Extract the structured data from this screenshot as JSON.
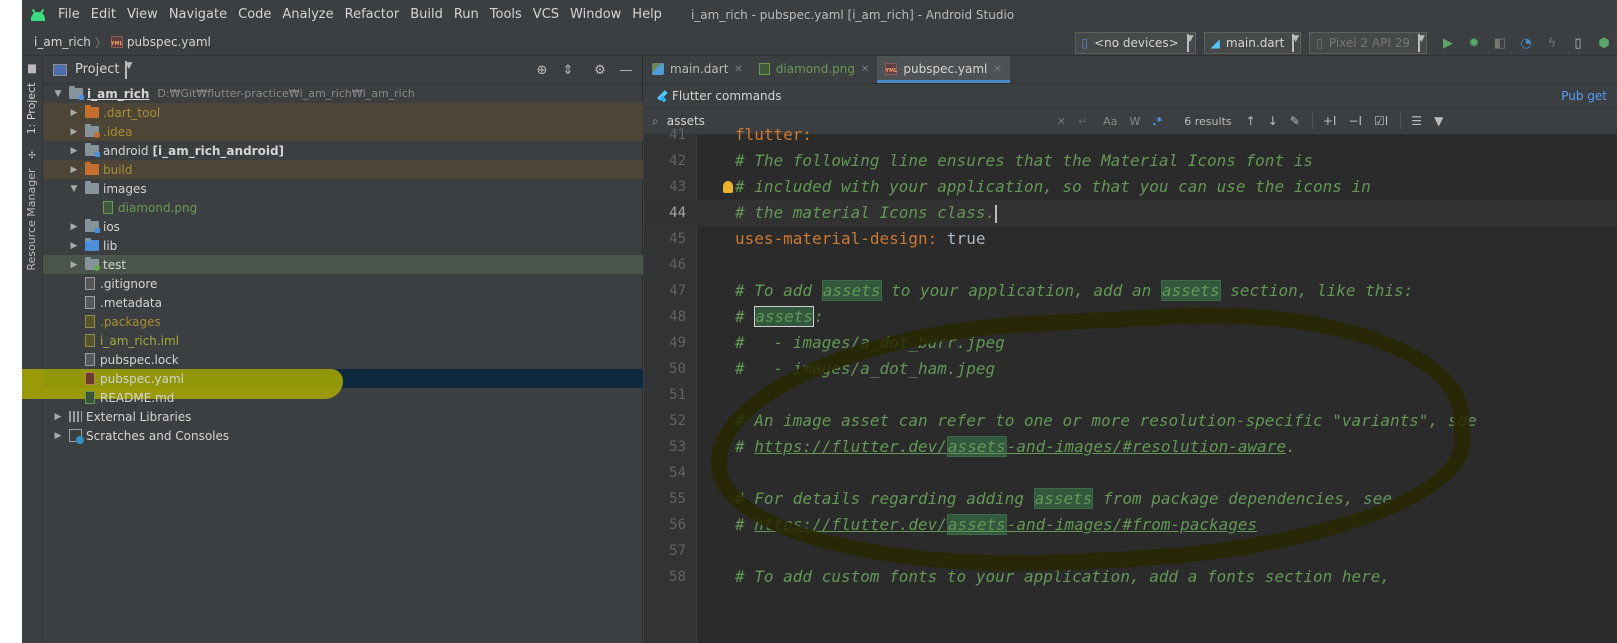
{
  "window": {
    "title": "i_am_rich - pubspec.yaml [i_am_rich] - Android Studio",
    "menu": [
      "File",
      "Edit",
      "View",
      "Navigate",
      "Code",
      "Analyze",
      "Refactor",
      "Build",
      "Run",
      "Tools",
      "VCS",
      "Window",
      "Help"
    ]
  },
  "navbar": {
    "crumbs": [
      "i_am_rich",
      "pubspec.yaml"
    ],
    "device_selector": "<no devices>",
    "run_config": "main.dart",
    "emulator": "Pixel 2 API 29"
  },
  "tool_strip": {
    "project_tab": "1: Project",
    "resource_tab": "Resource Manager"
  },
  "project_panel": {
    "title": "Project",
    "root_name": "i_am_rich",
    "root_path": "D:₩Git₩flutter-practice₩i_am_rich₩i_am_rich",
    "items": [
      {
        "label": ".dart_tool"
      },
      {
        "label": ".idea"
      },
      {
        "label": "android",
        "suffix": "[i_am_rich_android]"
      },
      {
        "label": "build"
      },
      {
        "label": "images"
      },
      {
        "label": "diamond.png"
      },
      {
        "label": "ios"
      },
      {
        "label": "lib"
      },
      {
        "label": "test"
      },
      {
        "label": ".gitignore"
      },
      {
        "label": ".metadata"
      },
      {
        "label": ".packages"
      },
      {
        "label": "i_am_rich.iml"
      },
      {
        "label": "pubspec.lock"
      },
      {
        "label": "pubspec.yaml"
      },
      {
        "label": "README.md"
      },
      {
        "label": "External Libraries"
      },
      {
        "label": "Scratches and Consoles"
      }
    ]
  },
  "editor": {
    "tabs": [
      "main.dart",
      "diamond.png",
      "pubspec.yaml"
    ],
    "flutter_bar": {
      "label": "Flutter commands",
      "action": "Pub get"
    },
    "search": {
      "query": "assets",
      "case_opt": "Aa",
      "word_opt": "W",
      "regex_opt": ".*",
      "results": "6 results"
    },
    "lines": [
      {
        "no": "41"
      },
      {
        "no": "42",
        "text": "# The following line ensures that the Material Icons font is"
      },
      {
        "no": "43",
        "text": "# included with your application, so that you can use the icons in"
      },
      {
        "no": "44",
        "text": "# the material Icons class."
      },
      {
        "no": "45",
        "key": "uses-material-design",
        "sep": ": ",
        "value": "true"
      },
      {
        "no": "46"
      },
      {
        "no": "47",
        "p1": "# To add ",
        "m1": "assets",
        "p2": " to your application, add an ",
        "m2": "assets",
        "p3": " section, like this:"
      },
      {
        "no": "48",
        "p1": "# ",
        "m1": "assets",
        "p2": ":"
      },
      {
        "no": "49",
        "text": "#   - images/a_dot_burr.jpeg"
      },
      {
        "no": "50",
        "text": "#   - images/a_dot_ham.jpeg"
      },
      {
        "no": "51"
      },
      {
        "no": "52",
        "text": "# An image asset can refer to one or more resolution-specific \"variants\", see"
      },
      {
        "no": "53",
        "p1": "# ",
        "l1": "https://flutter.dev/",
        "m1": "assets",
        "l2": "-and-images/#resolution-aware",
        "p2": "."
      },
      {
        "no": "54"
      },
      {
        "no": "55",
        "p1": "# For details regarding adding ",
        "m1": "assets",
        "p2": " from package dependencies, see"
      },
      {
        "no": "56",
        "p1": "# ",
        "l1": "https://flutter.dev/",
        "m1": "assets",
        "l2": "-and-images/#from-packages"
      },
      {
        "no": "57"
      },
      {
        "no": "58",
        "text": "# To add custom fonts to your application, add a fonts section here,"
      }
    ]
  },
  "colors": {
    "bg_panel": "#3c3f41",
    "bg_editor": "#2b2b2b",
    "comment": "#629755",
    "key": "#cc7832",
    "match_bg": "#32593d",
    "selection": "#0d293e",
    "accent": "#4a88c7"
  }
}
